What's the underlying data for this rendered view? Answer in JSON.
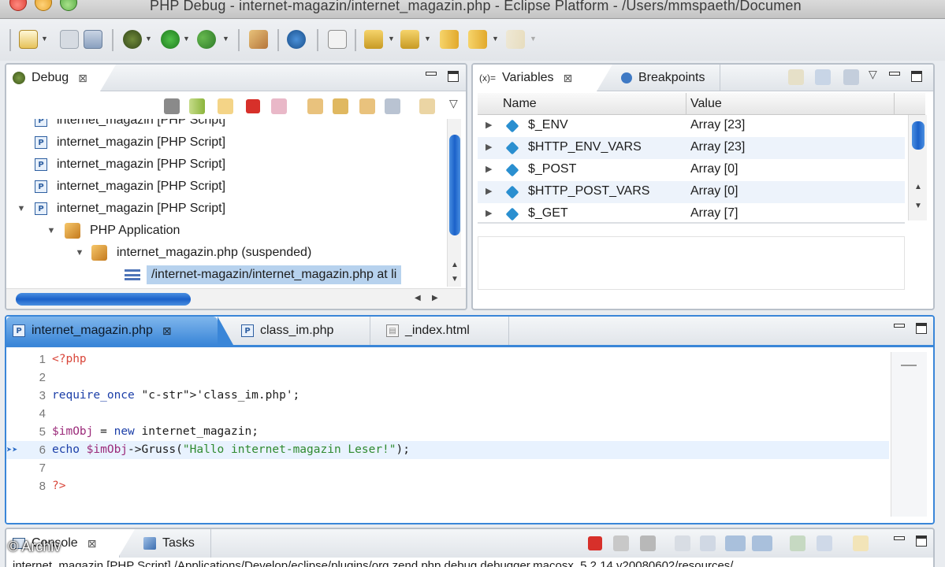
{
  "window": {
    "title": "PHP Debug - internet-magazin/internet_magazin.php - Eclipse Platform - /Users/mmspaeth/Documen"
  },
  "toolbar": {
    "icons": [
      "new-icon",
      "save-icon",
      "print-icon",
      "debug-icon",
      "run-icon",
      "external-tools-icon",
      "deploy-icon",
      "web-browser-icon",
      "file-icon",
      "next-annotation-icon",
      "previous-annotation-icon",
      "last-edit-icon",
      "back-icon",
      "forward-icon"
    ]
  },
  "debug_panel": {
    "tab_label": "Debug",
    "tree": [
      {
        "label": "internet_magazin [PHP Script]",
        "partial": true
      },
      {
        "label": "internet_magazin [PHP Script]"
      },
      {
        "label": "internet_magazin [PHP Script]"
      },
      {
        "label": "internet_magazin [PHP Script]"
      },
      {
        "label": "internet_magazin [PHP Script]",
        "expanded": true
      },
      {
        "label": "PHP Application",
        "expanded": true
      },
      {
        "label": "internet_magazin.php (suspended)",
        "expanded": true
      },
      {
        "label": "/internet-magazin/internet_magazin.php at li",
        "selected": true
      }
    ]
  },
  "variables_panel": {
    "tab_label": "Variables",
    "tab2_label": "Breakpoints",
    "tab_prefix": "(x)=",
    "columns": {
      "name": "Name",
      "value": "Value"
    },
    "rows": [
      {
        "name": "$_ENV",
        "value": "Array [23]"
      },
      {
        "name": "$HTTP_ENV_VARS",
        "value": "Array [23]"
      },
      {
        "name": "$_POST",
        "value": "Array [0]"
      },
      {
        "name": "$HTTP_POST_VARS",
        "value": "Array [0]"
      },
      {
        "name": "$_GET",
        "value": "Array [7]"
      }
    ]
  },
  "editor": {
    "tabs": [
      {
        "label": "internet_magazin.php",
        "active": true
      },
      {
        "label": "class_im.php"
      },
      {
        "label": "_index.html"
      }
    ],
    "lines": [
      {
        "n": "1",
        "text": "<?php"
      },
      {
        "n": "2",
        "text": ""
      },
      {
        "n": "3",
        "text": "require_once 'class_im.php';"
      },
      {
        "n": "4",
        "text": ""
      },
      {
        "n": "5",
        "text": "$imObj = new internet_magazin;"
      },
      {
        "n": "6",
        "text": "echo $imObj->Gruss(\"Hallo internet-magazin Leser!\");",
        "current": true
      },
      {
        "n": "7",
        "text": ""
      },
      {
        "n": "8",
        "text": "?>"
      }
    ]
  },
  "console": {
    "tab_label": "Console",
    "tab2_label": "Tasks",
    "output": "internet_magazin [PHP Script] /Applications/Develop/eclipse/plugins/org.zend.php.debug.debugger.macosx_5.2.14.v20080602/resources/"
  },
  "watermark": "© Archiv",
  "colors": {
    "selection": "#b7d2ee",
    "active_editor_tab": "#3a86d8",
    "scroll_thumb": "#1b61c9"
  }
}
